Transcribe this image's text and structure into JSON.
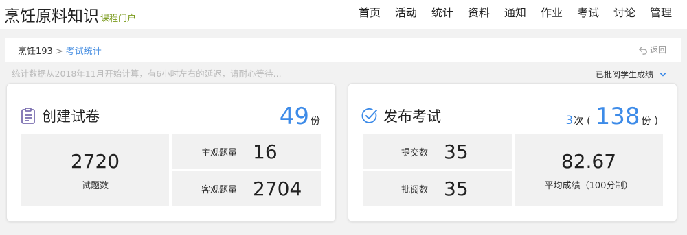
{
  "header": {
    "title": "烹饪原料知识",
    "subtitle": "课程门户",
    "nav": [
      "首页",
      "活动",
      "统计",
      "资料",
      "通知",
      "作业",
      "考试",
      "讨论",
      "管理"
    ]
  },
  "breadcrumb": {
    "root": "烹饪193",
    "separator": ">",
    "current": "考试统计"
  },
  "back_label": "返回",
  "notice": "统计数据从2018年11月开始计算，有6小时左右的延迟，请耐心等待...",
  "filter": {
    "selected": "已批阅学生成绩"
  },
  "card_create": {
    "title": "创建试卷",
    "count": "49",
    "unit": "份",
    "total_questions": {
      "value": "2720",
      "label": "试题数"
    },
    "subjective": {
      "label": "主观题量",
      "value": "16"
    },
    "objective": {
      "label": "客观题量",
      "value": "2704"
    }
  },
  "card_publish": {
    "title": "发布考试",
    "times": "3",
    "times_unit": "次",
    "paren_open": "(",
    "papers": "138",
    "papers_unit": "份",
    "paren_close": ")",
    "submitted": {
      "label": "提交数",
      "value": "35"
    },
    "graded": {
      "label": "批阅数",
      "value": "35"
    },
    "average": {
      "value": "82.67",
      "label": "平均成绩（100分制）"
    }
  },
  "colors": {
    "accent": "#3d8be8",
    "icon": "#7b6fb0",
    "logo_sub": "#7a9a1c"
  }
}
